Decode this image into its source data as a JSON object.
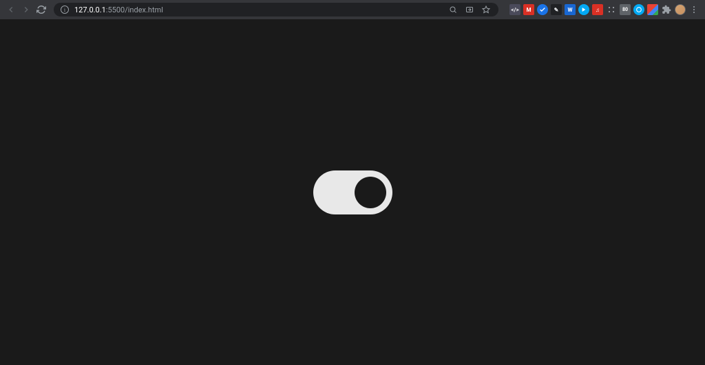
{
  "browser": {
    "url_host": "127.0.0.1",
    "url_port": ":5500",
    "url_path": "/index.html"
  },
  "extensions": {
    "ext1_label": "</>",
    "ext2_label": "M",
    "ext4_label": "✎",
    "ext5_label": "W",
    "ext7_label": "♫",
    "ext9_label": "80"
  },
  "toggle": {
    "state": "on"
  }
}
